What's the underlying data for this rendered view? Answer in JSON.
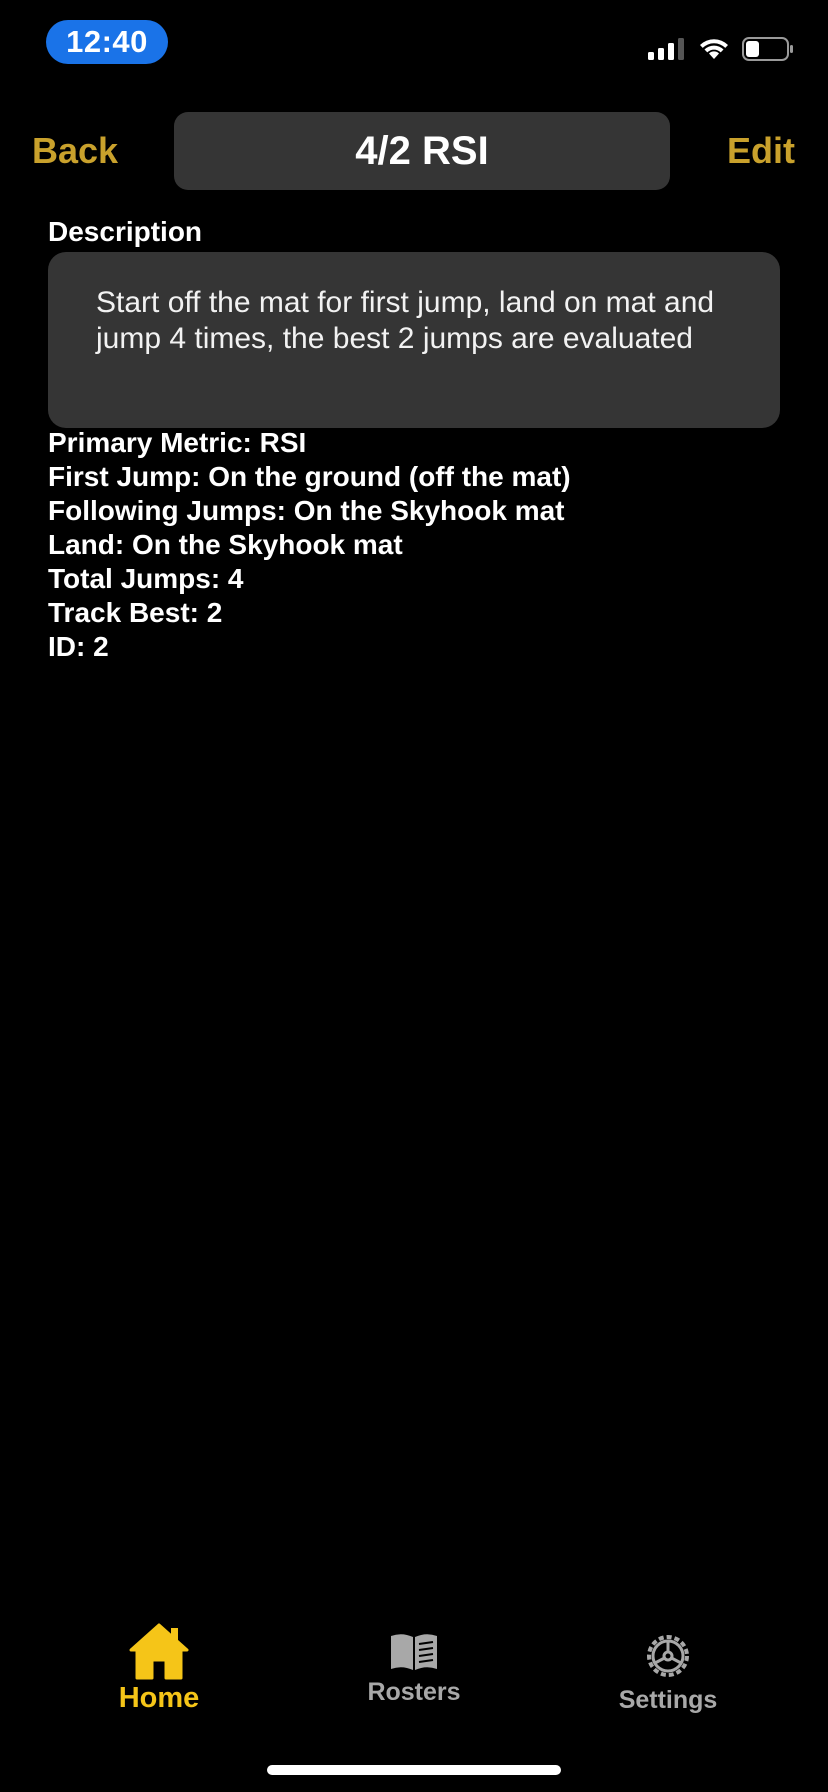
{
  "status_bar": {
    "time": "12:40",
    "icons": [
      "cellular-signal-icon",
      "wifi-icon",
      "battery-icon"
    ]
  },
  "nav": {
    "back_label": "Back",
    "title": "4/2 RSI",
    "edit_label": "Edit"
  },
  "description": {
    "heading": "Description",
    "text": "Start off the mat for first jump, land on mat and jump 4 times, the best 2 jumps are evaluated"
  },
  "details": [
    "Primary Metric: RSI",
    "First Jump: On the ground (off the mat)",
    "Following Jumps: On the Skyhook mat",
    "Land: On the Skyhook mat",
    "Total Jumps: 4",
    "Track Best: 2",
    "ID: 2"
  ],
  "tabs": [
    {
      "label": "Home",
      "icon": "home-icon",
      "active": true
    },
    {
      "label": "Rosters",
      "icon": "book-icon",
      "active": false
    },
    {
      "label": "Settings",
      "icon": "gear-icon",
      "active": false
    }
  ],
  "colors": {
    "accent_gold": "#c9a12c",
    "active_tab": "#f5c518",
    "inactive_tab": "#a8a8a8",
    "panel": "#353535",
    "time_pill": "#1a73e8",
    "background": "#000000"
  }
}
